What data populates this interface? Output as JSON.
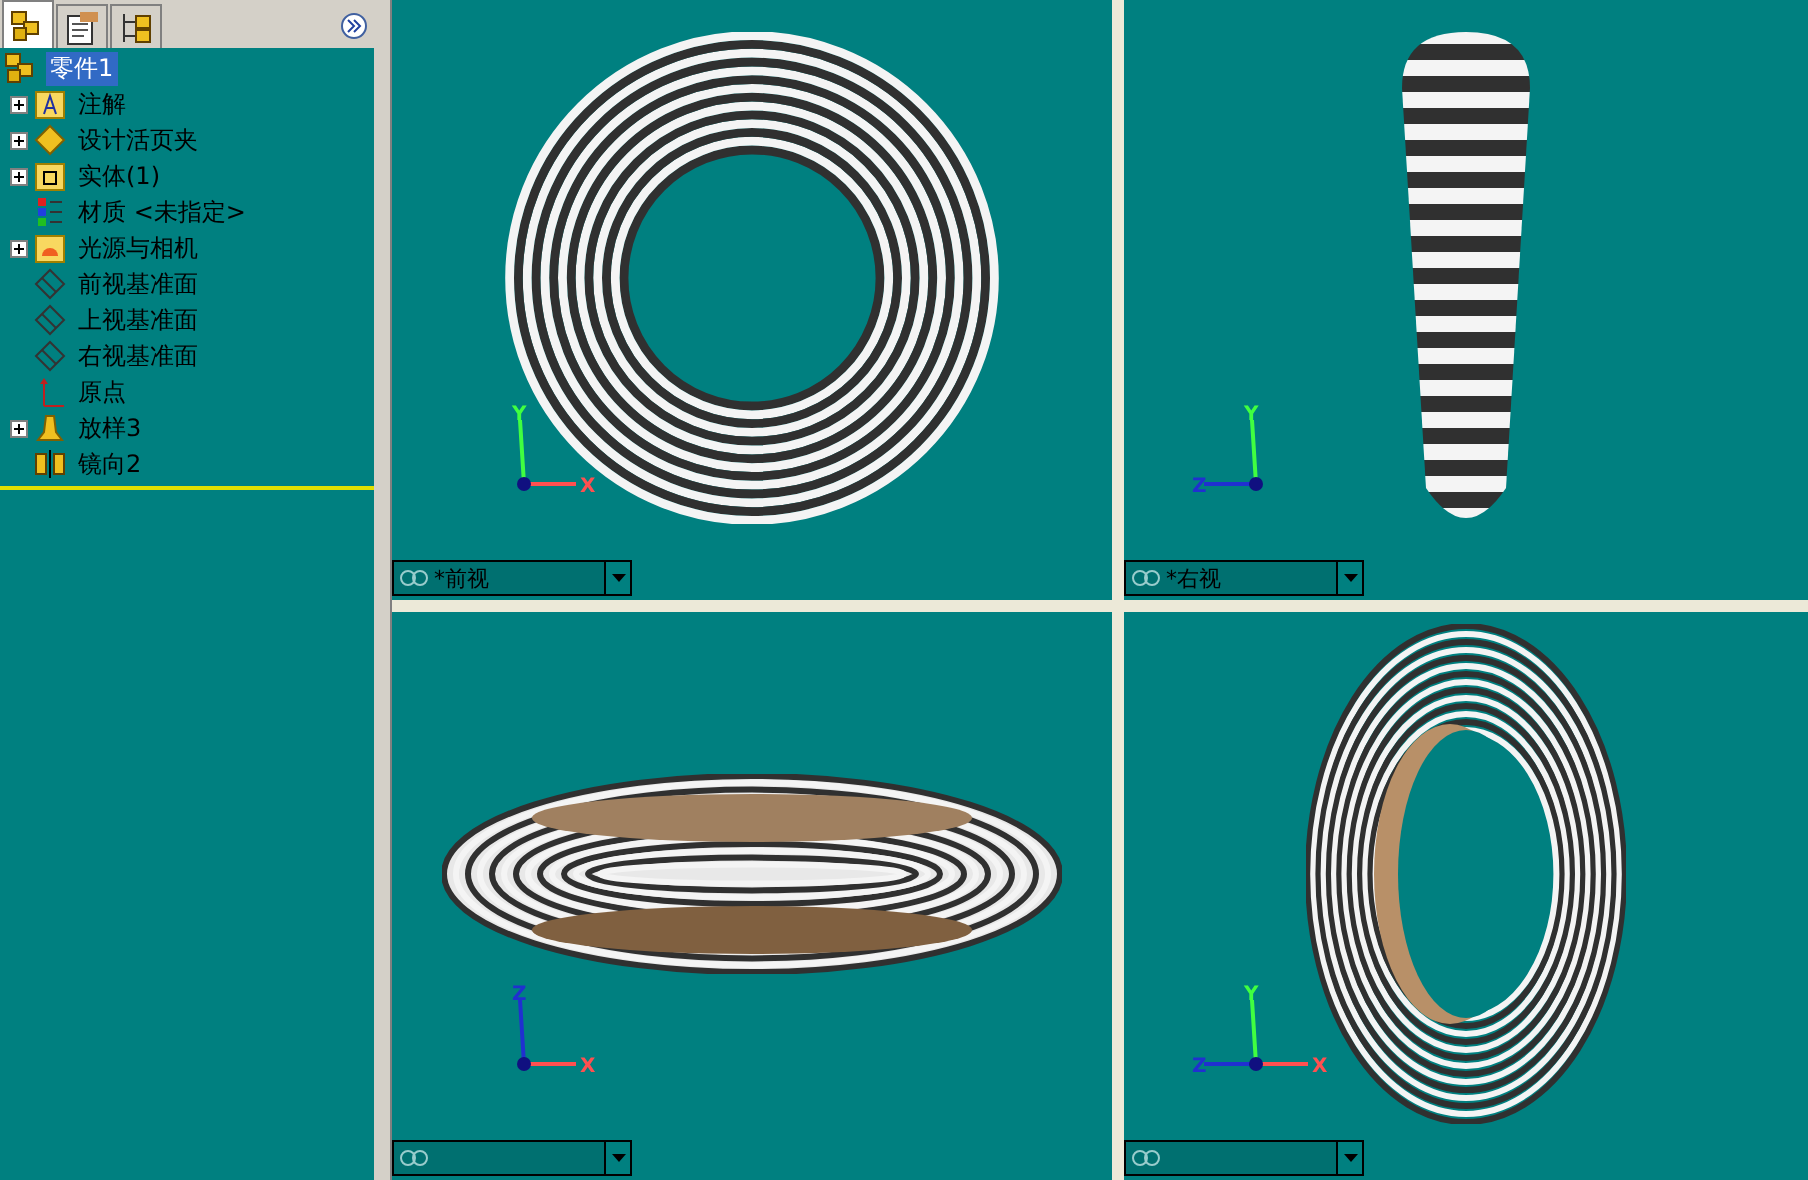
{
  "panel_tabs": [
    {
      "kind": "part",
      "selected": true
    },
    {
      "kind": "properties",
      "selected": false
    },
    {
      "kind": "config",
      "selected": false
    }
  ],
  "tree": {
    "root": {
      "label": "零件1",
      "selected": true
    },
    "items": [
      {
        "label": "注解",
        "kind": "annotation",
        "expandable": true
      },
      {
        "label": "设计活页夹",
        "kind": "binder",
        "expandable": true
      },
      {
        "label": "实体(1)",
        "kind": "solid",
        "expandable": true
      },
      {
        "label": "材质 <未指定>",
        "kind": "material",
        "expandable": false
      },
      {
        "label": "光源与相机",
        "kind": "lights",
        "expandable": true
      },
      {
        "label": "前视基准面",
        "kind": "plane",
        "expandable": false
      },
      {
        "label": "上视基准面",
        "kind": "plane",
        "expandable": false
      },
      {
        "label": "右视基准面",
        "kind": "plane",
        "expandable": false
      },
      {
        "label": "原点",
        "kind": "origin",
        "expandable": false
      },
      {
        "label": "放样3",
        "kind": "loft",
        "expandable": true
      },
      {
        "label": "镜向2",
        "kind": "mirror",
        "expandable": false
      }
    ]
  },
  "viewports": [
    {
      "kind": "front",
      "label": "*前视",
      "axes": [
        {
          "letter": "Y",
          "kind": "up"
        },
        {
          "letter": "X",
          "kind": "right"
        }
      ]
    },
    {
      "kind": "right",
      "label": "*右视",
      "axes": [
        {
          "letter": "Y",
          "kind": "up"
        },
        {
          "letter": "Z",
          "kind": "left"
        }
      ]
    },
    {
      "kind": "bottom",
      "axes": [
        {
          "letter": "Z",
          "kind": "up"
        },
        {
          "letter": "X",
          "kind": "right"
        }
      ]
    },
    {
      "kind": "iso",
      "axes": [
        {
          "letter": "Y",
          "kind": "up"
        },
        {
          "letter": "Z",
          "kind": "left"
        },
        {
          "letter": "X",
          "kind": "right"
        }
      ]
    }
  ]
}
